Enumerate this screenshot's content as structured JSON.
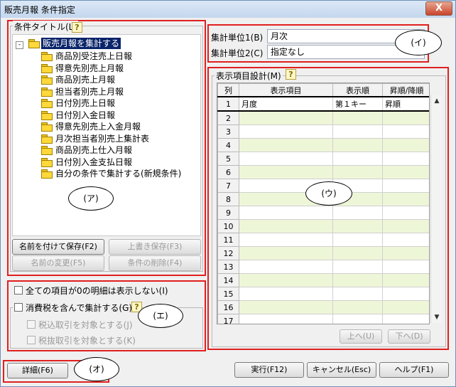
{
  "window": {
    "title": "販売月報 条件指定",
    "close_glyph": "X"
  },
  "conditions": {
    "label": "条件タイトル(L)",
    "help": "?",
    "tree_root": "販売月報を集計する",
    "tree_items": [
      "商品別受注売上日報",
      "得意先別売上月報",
      "商品別売上月報",
      "担当者別売上月報",
      "日付別売上日報",
      "日付別入金日報",
      "得意先別売上入金月報",
      "月次担当者別売上集計表",
      "商品別売上仕入月報",
      "日付別入金支払日報",
      "自分の条件で集計する(新規条件)"
    ],
    "callout": "(ア)",
    "buttons": {
      "save_as": "名前を付けて保存(F2)",
      "overwrite": "上書き保存(F3)",
      "rename": "名前の変更(F5)",
      "delete": "条件の削除(F4)"
    }
  },
  "options": {
    "hide_zero": "全ての項目が0の明細は表示しない(I)",
    "include_tax": "消費税を含んで集計する(G)",
    "help": "?",
    "tax_in": "税込取引を対象とする(J)",
    "tax_out": "税抜取引を対象とする(K)",
    "callout": "(エ)"
  },
  "units": {
    "unit1_label": "集計単位1(B)",
    "unit1_value": "月次",
    "unit2_label": "集計単位2(C)",
    "unit2_value": "指定なし",
    "callout": "(イ)"
  },
  "display": {
    "label": "表示項目設計(M)",
    "help": "?",
    "columns": [
      "列",
      "表示項目",
      "表示順",
      "昇順/降順"
    ],
    "rows": [
      {
        "no": "1",
        "item": "月度",
        "order": "第１キー",
        "dir": "昇順"
      },
      {
        "no": "2",
        "item": "",
        "order": "",
        "dir": ""
      },
      {
        "no": "3",
        "item": "",
        "order": "",
        "dir": ""
      },
      {
        "no": "4",
        "item": "",
        "order": "",
        "dir": ""
      },
      {
        "no": "5",
        "item": "",
        "order": "",
        "dir": ""
      },
      {
        "no": "6",
        "item": "",
        "order": "",
        "dir": ""
      },
      {
        "no": "7",
        "item": "",
        "order": "",
        "dir": ""
      },
      {
        "no": "8",
        "item": "",
        "order": "",
        "dir": ""
      },
      {
        "no": "9",
        "item": "",
        "order": "",
        "dir": ""
      },
      {
        "no": "10",
        "item": "",
        "order": "",
        "dir": ""
      },
      {
        "no": "11",
        "item": "",
        "order": "",
        "dir": ""
      },
      {
        "no": "12",
        "item": "",
        "order": "",
        "dir": ""
      },
      {
        "no": "13",
        "item": "",
        "order": "",
        "dir": ""
      },
      {
        "no": "14",
        "item": "",
        "order": "",
        "dir": ""
      },
      {
        "no": "15",
        "item": "",
        "order": "",
        "dir": ""
      },
      {
        "no": "16",
        "item": "",
        "order": "",
        "dir": ""
      },
      {
        "no": "17",
        "item": "",
        "order": "",
        "dir": ""
      }
    ],
    "up": "上へ(U)",
    "down": "下へ(D)",
    "callout": "(ウ)"
  },
  "footer": {
    "detail": "詳細(F6)",
    "callout": "(オ)",
    "run": "実行(F12)",
    "cancel": "キャンセル(Esc)",
    "help": "ヘルプ(F1)"
  },
  "colors": {
    "highlight_red": "#e02020",
    "row_alt": "#eef6d8",
    "selection": "#0a246a"
  }
}
